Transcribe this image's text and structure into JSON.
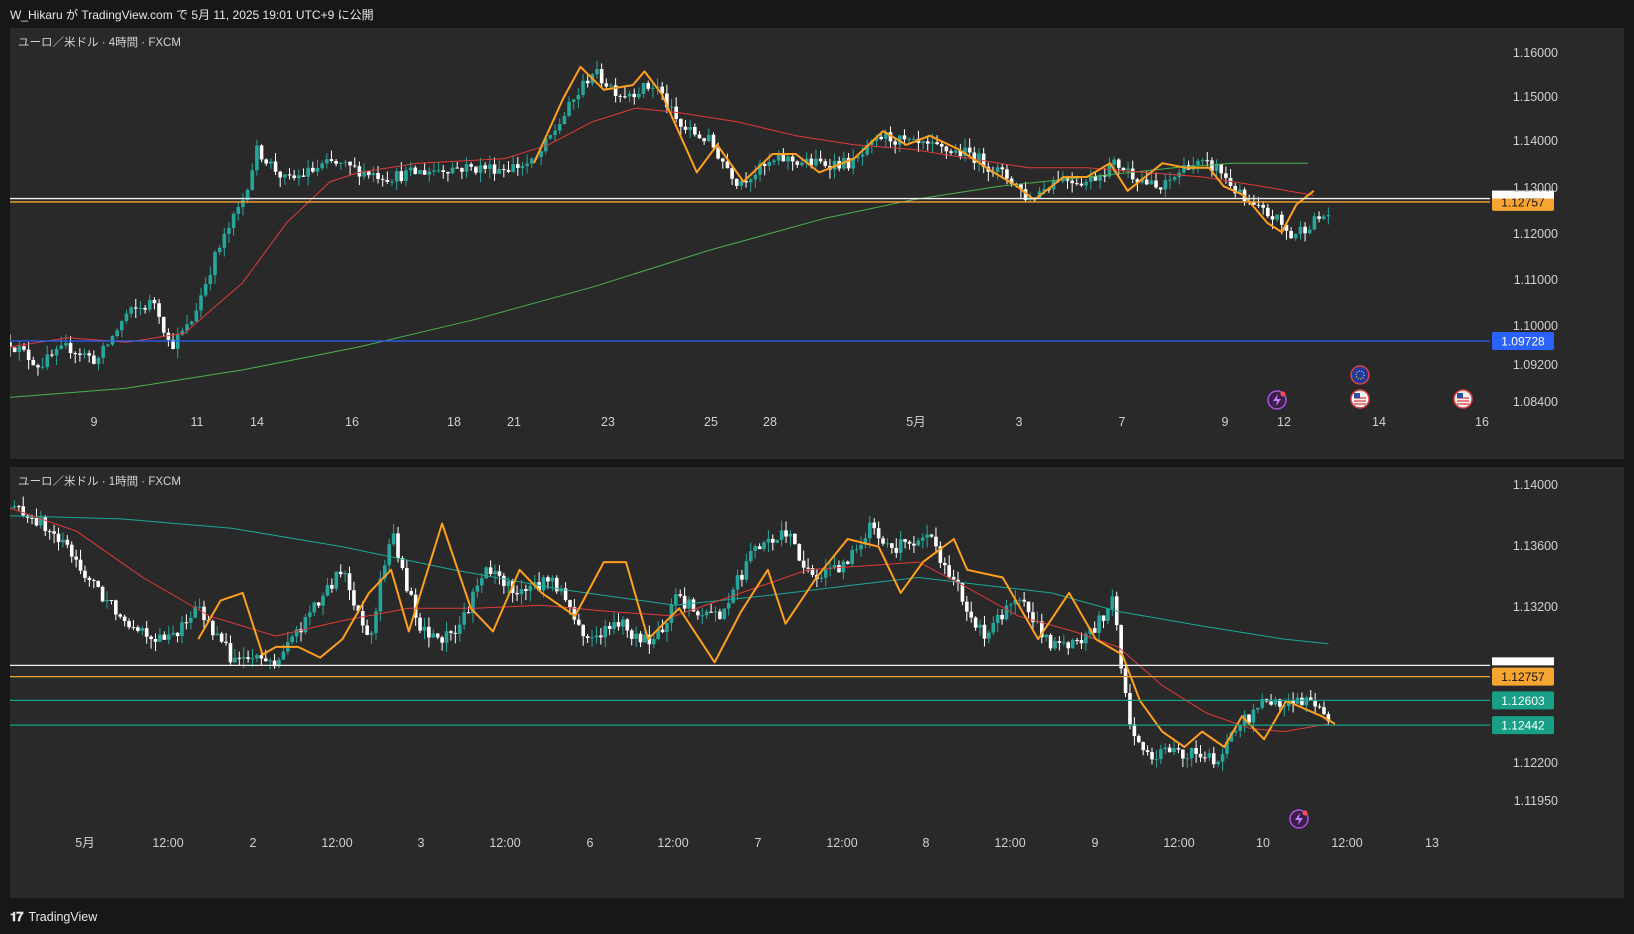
{
  "header": {
    "publish_text": "W_Hikaru が TradingView.com で 5月 11, 2025 19:01 UTC+9 に公開"
  },
  "footer": {
    "brand": "TradingView",
    "logo_icon": "tradingview-logo-icon"
  },
  "colors": {
    "background": "#171717",
    "pane": "#292929",
    "bull": "#26a69a",
    "bear": "#ffffff",
    "zigzag": "#ff9f1a",
    "ma_red": "#e03a3a",
    "ma_green": "#4caf50",
    "ma_teal": "#1aa898",
    "hline_blue": "#2962ff",
    "hline_orange": "#f7a531",
    "hline_green": "#17a085"
  },
  "chart_data": [
    {
      "type": "candlestick",
      "title": "ユーロ／米ドル · 4時間 · FXCM",
      "ylim": [
        1.083,
        1.165
      ],
      "y_ticks": [
        "1.16000",
        "1.15000",
        "1.14000",
        "1.13000",
        "1.12000",
        "1.11000",
        "1.10000",
        "1.09200",
        "1.08400"
      ],
      "x_ticks": [
        "9",
        "11",
        "14",
        "16",
        "18",
        "21",
        "23",
        "25",
        "28",
        "5月",
        "3",
        "7",
        "9",
        "12",
        "14",
        "16"
      ],
      "n_candles": 284,
      "ohlc_anchors": [
        [
          0,
          1.097
        ],
        [
          10,
          1.092
        ],
        [
          20,
          1.096
        ],
        [
          30,
          1.093
        ],
        [
          40,
          1.103
        ],
        [
          50,
          1.106
        ],
        [
          55,
          1.096
        ],
        [
          62,
          1.101
        ],
        [
          70,
          1.115
        ],
        [
          80,
          1.128
        ],
        [
          85,
          1.139
        ],
        [
          95,
          1.132
        ],
        [
          110,
          1.136
        ],
        [
          130,
          1.133
        ],
        [
          150,
          1.135
        ],
        [
          170,
          1.135
        ],
        [
          180,
          1.136
        ],
        [
          200,
          1.156
        ],
        [
          210,
          1.151
        ],
        [
          222,
          1.153
        ],
        [
          230,
          1.144
        ],
        [
          240,
          1.141
        ],
        [
          250,
          1.132
        ],
        [
          265,
          1.137
        ],
        [
          275,
          1.136
        ],
        [
          290,
          1.136
        ],
        [
          300,
          1.142
        ],
        [
          310,
          1.14
        ],
        [
          330,
          1.138
        ],
        [
          345,
          1.132
        ],
        [
          350,
          1.128
        ],
        [
          360,
          1.133
        ],
        [
          370,
          1.132
        ],
        [
          380,
          1.136
        ],
        [
          395,
          1.13
        ],
        [
          405,
          1.136
        ],
        [
          415,
          1.135
        ],
        [
          425,
          1.127
        ],
        [
          435,
          1.124
        ],
        [
          440,
          1.12
        ],
        [
          447,
          1.123
        ],
        [
          453,
          1.125
        ]
      ],
      "ma_red": [
        [
          0,
          1.096
        ],
        [
          20,
          1.098
        ],
        [
          40,
          1.097
        ],
        [
          60,
          1.099
        ],
        [
          80,
          1.11
        ],
        [
          95,
          1.123
        ],
        [
          110,
          1.132
        ],
        [
          120,
          1.134
        ],
        [
          140,
          1.136
        ],
        [
          170,
          1.137
        ],
        [
          185,
          1.14
        ],
        [
          200,
          1.145
        ],
        [
          215,
          1.148
        ],
        [
          230,
          1.147
        ],
        [
          250,
          1.145
        ],
        [
          270,
          1.142
        ],
        [
          290,
          1.14
        ],
        [
          310,
          1.139
        ],
        [
          330,
          1.137
        ],
        [
          350,
          1.135
        ],
        [
          370,
          1.135
        ],
        [
          390,
          1.134
        ],
        [
          410,
          1.133
        ],
        [
          430,
          1.131
        ],
        [
          448,
          1.129
        ]
      ],
      "ma_green": [
        [
          0,
          1.085
        ],
        [
          40,
          1.087
        ],
        [
          80,
          1.091
        ],
        [
          120,
          1.096
        ],
        [
          160,
          1.102
        ],
        [
          200,
          1.109
        ],
        [
          240,
          1.117
        ],
        [
          280,
          1.124
        ],
        [
          310,
          1.128
        ],
        [
          340,
          1.131
        ],
        [
          370,
          1.133
        ],
        [
          400,
          1.135
        ],
        [
          420,
          1.136
        ],
        [
          446,
          1.136
        ]
      ],
      "zigzag": [
        [
          180,
          1.136
        ],
        [
          190,
          1.15
        ],
        [
          196,
          1.157
        ],
        [
          204,
          1.152
        ],
        [
          214,
          1.153
        ],
        [
          218,
          1.156
        ],
        [
          224,
          1.151
        ],
        [
          236,
          1.134
        ],
        [
          243,
          1.14
        ],
        [
          252,
          1.132
        ],
        [
          262,
          1.138
        ],
        [
          270,
          1.138
        ],
        [
          278,
          1.134
        ],
        [
          290,
          1.137
        ],
        [
          300,
          1.143
        ],
        [
          308,
          1.14
        ],
        [
          316,
          1.142
        ],
        [
          326,
          1.139
        ],
        [
          338,
          1.134
        ],
        [
          346,
          1.131
        ],
        [
          352,
          1.128
        ],
        [
          362,
          1.133
        ],
        [
          370,
          1.133
        ],
        [
          378,
          1.136
        ],
        [
          384,
          1.13
        ],
        [
          396,
          1.136
        ],
        [
          404,
          1.135
        ],
        [
          412,
          1.135
        ],
        [
          417,
          1.131
        ],
        [
          424,
          1.129
        ],
        [
          432,
          1.123
        ],
        [
          437,
          1.121
        ],
        [
          442,
          1.127
        ],
        [
          448,
          1.13
        ]
      ],
      "horizontal_lines": [
        {
          "price": 1.12757,
          "label": "1.12757",
          "color": "#f7a531"
        },
        {
          "price": 1.1283,
          "label": "",
          "color": "#f0f0f0"
        },
        {
          "price": 1.09728,
          "label": "1.09728",
          "color": "#2962ff"
        }
      ],
      "event_icons": [
        "lightning-event-icon",
        "eu-flag-icon",
        "us-flag-icon",
        "us-flag-icon"
      ]
    },
    {
      "type": "candlestick",
      "title": "ユーロ／米ドル · 1時間 · FXCM",
      "ylim": [
        1.1185,
        1.1425
      ],
      "y_ticks": [
        "1.14000",
        "1.13600",
        "1.13200",
        "1.12200",
        "1.11950"
      ],
      "x_ticks": [
        "5月",
        "12:00",
        "2",
        "12:00",
        "3",
        "12:00",
        "6",
        "12:00",
        "7",
        "12:00",
        "8",
        "12:00",
        "9",
        "12:00",
        "10",
        "12:00",
        "13"
      ],
      "n_candles": 300,
      "ohlc_anchors": [
        [
          0,
          1.1385
        ],
        [
          10,
          1.138
        ],
        [
          25,
          1.136
        ],
        [
          40,
          1.133
        ],
        [
          55,
          1.131
        ],
        [
          70,
          1.1298
        ],
        [
          85,
          1.132
        ],
        [
          100,
          1.1288
        ],
        [
          120,
          1.1285
        ],
        [
          135,
          1.1315
        ],
        [
          150,
          1.1345
        ],
        [
          162,
          1.13
        ],
        [
          172,
          1.137
        ],
        [
          185,
          1.1305
        ],
        [
          200,
          1.13
        ],
        [
          215,
          1.1345
        ],
        [
          230,
          1.133
        ],
        [
          245,
          1.134
        ],
        [
          260,
          1.13
        ],
        [
          275,
          1.131
        ],
        [
          290,
          1.1295
        ],
        [
          300,
          1.1325
        ],
        [
          320,
          1.1315
        ],
        [
          335,
          1.1355
        ],
        [
          350,
          1.137
        ],
        [
          362,
          1.134
        ],
        [
          375,
          1.1345
        ],
        [
          388,
          1.1372
        ],
        [
          400,
          1.136
        ],
        [
          415,
          1.1365
        ],
        [
          425,
          1.134
        ],
        [
          440,
          1.13
        ],
        [
          455,
          1.133
        ],
        [
          470,
          1.1295
        ],
        [
          485,
          1.1298
        ],
        [
          498,
          1.1325
        ],
        [
          505,
          1.1245
        ],
        [
          513,
          1.1225
        ],
        [
          522,
          1.1228
        ],
        [
          535,
          1.1225
        ],
        [
          545,
          1.1222
        ],
        [
          555,
          1.1245
        ],
        [
          566,
          1.1258
        ],
        [
          578,
          1.126
        ],
        [
          588,
          1.1258
        ],
        [
          595,
          1.1247
        ]
      ],
      "ma_red": [
        [
          0,
          1.1385
        ],
        [
          30,
          1.137
        ],
        [
          60,
          1.134
        ],
        [
          90,
          1.1315
        ],
        [
          120,
          1.1302
        ],
        [
          150,
          1.1312
        ],
        [
          180,
          1.132
        ],
        [
          210,
          1.132
        ],
        [
          240,
          1.1322
        ],
        [
          270,
          1.1318
        ],
        [
          300,
          1.1315
        ],
        [
          330,
          1.133
        ],
        [
          360,
          1.1345
        ],
        [
          390,
          1.1348
        ],
        [
          410,
          1.135
        ],
        [
          430,
          1.1335
        ],
        [
          455,
          1.1315
        ],
        [
          480,
          1.1305
        ],
        [
          500,
          1.1295
        ],
        [
          520,
          1.127
        ],
        [
          540,
          1.1252
        ],
        [
          560,
          1.1242
        ],
        [
          575,
          1.124
        ],
        [
          595,
          1.1245
        ]
      ],
      "ma_teal": [
        [
          0,
          1.138
        ],
        [
          50,
          1.1378
        ],
        [
          100,
          1.1372
        ],
        [
          150,
          1.136
        ],
        [
          200,
          1.1345
        ],
        [
          250,
          1.1332
        ],
        [
          300,
          1.1322
        ],
        [
          340,
          1.1328
        ],
        [
          380,
          1.1335
        ],
        [
          410,
          1.134
        ],
        [
          440,
          1.1335
        ],
        [
          470,
          1.133
        ],
        [
          500,
          1.1318
        ],
        [
          540,
          1.1308
        ],
        [
          575,
          1.13
        ],
        [
          595,
          1.1297
        ]
      ],
      "zigzag": [
        [
          85,
          1.13
        ],
        [
          95,
          1.1325
        ],
        [
          105,
          1.133
        ],
        [
          114,
          1.129
        ],
        [
          120,
          1.1295
        ],
        [
          130,
          1.1295
        ],
        [
          140,
          1.1288
        ],
        [
          150,
          1.13
        ],
        [
          162,
          1.133
        ],
        [
          172,
          1.1345
        ],
        [
          180,
          1.1305
        ],
        [
          195,
          1.1375
        ],
        [
          208,
          1.132
        ],
        [
          218,
          1.1305
        ],
        [
          230,
          1.1345
        ],
        [
          240,
          1.133
        ],
        [
          255,
          1.1315
        ],
        [
          268,
          1.135
        ],
        [
          278,
          1.135
        ],
        [
          288,
          1.13
        ],
        [
          302,
          1.132
        ],
        [
          318,
          1.1285
        ],
        [
          330,
          1.1318
        ],
        [
          342,
          1.1345
        ],
        [
          350,
          1.131
        ],
        [
          364,
          1.134
        ],
        [
          378,
          1.1365
        ],
        [
          392,
          1.136
        ],
        [
          402,
          1.133
        ],
        [
          412,
          1.135
        ],
        [
          426,
          1.1365
        ],
        [
          432,
          1.1345
        ],
        [
          448,
          1.134
        ],
        [
          464,
          1.13
        ],
        [
          478,
          1.133
        ],
        [
          490,
          1.13
        ],
        [
          502,
          1.129
        ],
        [
          510,
          1.126
        ],
        [
          520,
          1.124
        ],
        [
          530,
          1.123
        ],
        [
          538,
          1.124
        ],
        [
          548,
          1.123
        ],
        [
          556,
          1.125
        ],
        [
          566,
          1.1235
        ],
        [
          576,
          1.126
        ],
        [
          584,
          1.1255
        ],
        [
          592,
          1.125
        ],
        [
          598,
          1.1245
        ]
      ],
      "horizontal_lines": [
        {
          "price": 1.1283,
          "label": "",
          "color": "#f0f0f0"
        },
        {
          "price": 1.12757,
          "label": "1.12757",
          "color": "#f7a531"
        },
        {
          "price": 1.12603,
          "label": "1.12603",
          "color": "#17a085"
        },
        {
          "price": 1.12442,
          "label": "1.12442",
          "color": "#17a085"
        }
      ],
      "event_icons": [
        "lightning-event-icon"
      ]
    }
  ]
}
